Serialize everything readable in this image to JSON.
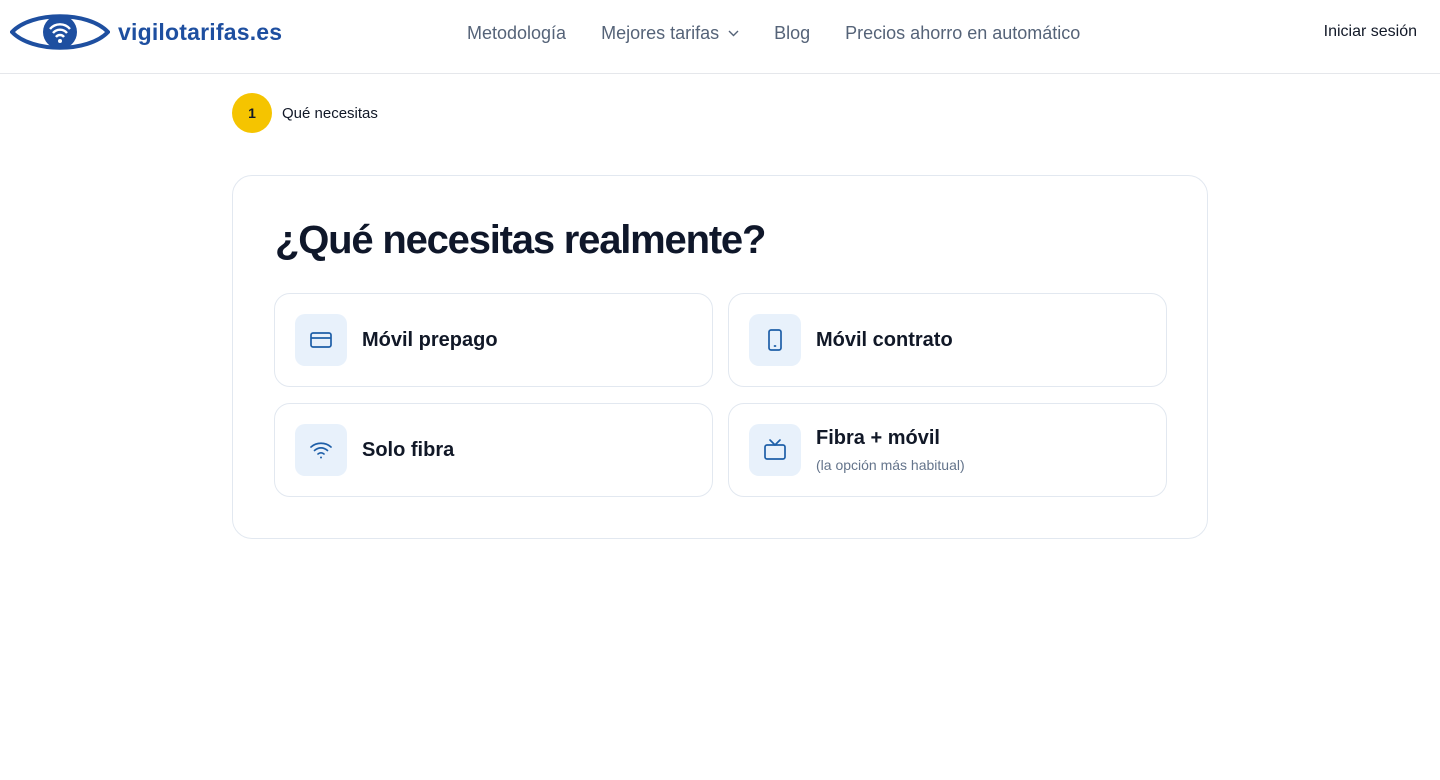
{
  "header": {
    "brand": "vigilotarifas.es",
    "logo_icon": "eye-logo",
    "nav": [
      {
        "label": "Metodología"
      },
      {
        "label": "Mejores tarifas",
        "dropdown": true
      },
      {
        "label": "Blog"
      },
      {
        "label": "Precios ahorro en automático"
      }
    ],
    "signin_label": "Iniciar sesión"
  },
  "stepper": {
    "number": "1",
    "label": "Qué necesitas",
    "accent": "#f5c400"
  },
  "main": {
    "title": "¿Qué necesitas realmente?",
    "options": [
      {
        "title": "Móvil prepago",
        "subtitle": "",
        "icon": "credit-card-icon"
      },
      {
        "title": "Móvil contrato",
        "subtitle": "",
        "icon": "smartphone-icon"
      },
      {
        "title": "Solo fibra",
        "subtitle": "",
        "icon": "wifi-icon"
      },
      {
        "title": "Fibra + móvil",
        "subtitle": "(la opción más habitual)",
        "icon": "tv-icon"
      }
    ]
  },
  "colors": {
    "brand": "#1e4fa0",
    "icon_bg": "#e8f1fb",
    "icon_stroke": "#1e5fa8",
    "nav_text": "#556378"
  }
}
